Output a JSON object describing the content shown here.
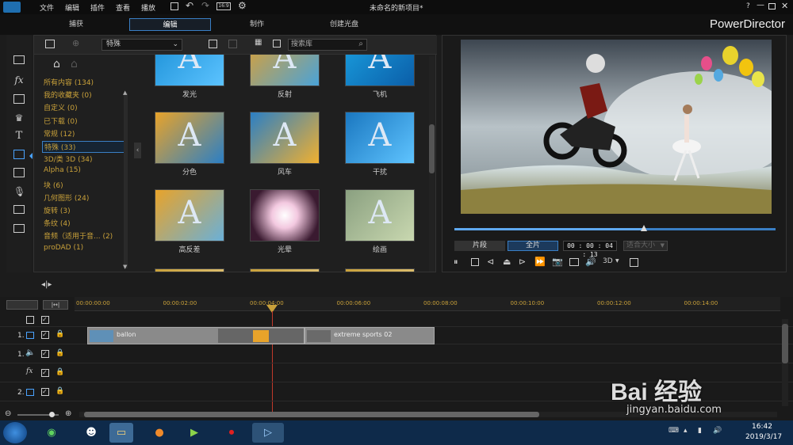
{
  "menubar": {
    "items": [
      "文件",
      "编辑",
      "插件",
      "查看",
      "播放"
    ],
    "title": "未命名的新项目*",
    "help": "?"
  },
  "modes": {
    "tabs": [
      "捕获",
      "编辑",
      "制作",
      "创建光盘"
    ]
  },
  "brand": "PowerDirector",
  "library": {
    "dropdown_value": "特殊",
    "search_placeholder": "搜索库",
    "categories": [
      "所有内容 (134)",
      "我的收藏夹 (0)",
      "自定义 (0)",
      "已下载 (0)",
      "常规 (12)",
      "特殊 (33)",
      "3D/类 3D (34)",
      "Alpha (15)",
      "块 (6)",
      "几何图形 (24)",
      "旋转 (3)",
      "条纹 (4)",
      "音频（适用于音... (2)",
      "proDAD (1)"
    ],
    "thumbs": [
      "发光",
      "反射",
      "飞机",
      "分色",
      "风车",
      "干扰",
      "高反差",
      "光晕",
      "绘画"
    ]
  },
  "preview": {
    "btn_clip": "片段",
    "btn_movie": "全片",
    "timecode": "00 : 00 : 04 : 13",
    "size_label": "适合大小",
    "mode_3d": "3D",
    "progress": 0.59
  },
  "timeline": {
    "ruler": [
      "00:00:00:00",
      "00:00:02:00",
      "00:00:04:00",
      "00:00:06:00",
      "00:00:08:00",
      "00:00:10:00",
      "00:00:12:00",
      "00:00:14:00"
    ],
    "tracks": [
      "1.",
      "1.",
      "",
      "2."
    ],
    "clips": [
      "ballon",
      "extreme sports 02"
    ]
  },
  "taskbar": {
    "time": "16:42",
    "date": "2019/3/17"
  },
  "watermark": {
    "text": "Bai 经验",
    "url": "jingyan.baidu.com"
  }
}
